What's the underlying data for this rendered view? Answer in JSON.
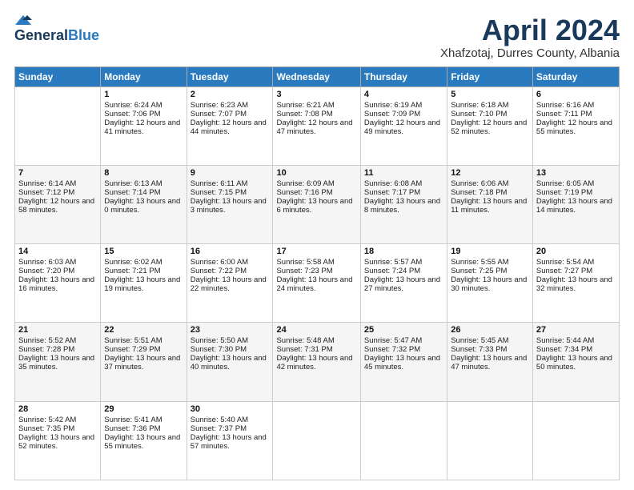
{
  "logo": {
    "line1": "General",
    "line2": "Blue"
  },
  "title": "April 2024",
  "location": "Xhafzotaj, Durres County, Albania",
  "weekdays": [
    "Sunday",
    "Monday",
    "Tuesday",
    "Wednesday",
    "Thursday",
    "Friday",
    "Saturday"
  ],
  "weeks": [
    [
      {
        "day": "",
        "sunrise": "",
        "sunset": "",
        "daylight": ""
      },
      {
        "day": "1",
        "sunrise": "Sunrise: 6:24 AM",
        "sunset": "Sunset: 7:06 PM",
        "daylight": "Daylight: 12 hours and 41 minutes."
      },
      {
        "day": "2",
        "sunrise": "Sunrise: 6:23 AM",
        "sunset": "Sunset: 7:07 PM",
        "daylight": "Daylight: 12 hours and 44 minutes."
      },
      {
        "day": "3",
        "sunrise": "Sunrise: 6:21 AM",
        "sunset": "Sunset: 7:08 PM",
        "daylight": "Daylight: 12 hours and 47 minutes."
      },
      {
        "day": "4",
        "sunrise": "Sunrise: 6:19 AM",
        "sunset": "Sunset: 7:09 PM",
        "daylight": "Daylight: 12 hours and 49 minutes."
      },
      {
        "day": "5",
        "sunrise": "Sunrise: 6:18 AM",
        "sunset": "Sunset: 7:10 PM",
        "daylight": "Daylight: 12 hours and 52 minutes."
      },
      {
        "day": "6",
        "sunrise": "Sunrise: 6:16 AM",
        "sunset": "Sunset: 7:11 PM",
        "daylight": "Daylight: 12 hours and 55 minutes."
      }
    ],
    [
      {
        "day": "7",
        "sunrise": "Sunrise: 6:14 AM",
        "sunset": "Sunset: 7:12 PM",
        "daylight": "Daylight: 12 hours and 58 minutes."
      },
      {
        "day": "8",
        "sunrise": "Sunrise: 6:13 AM",
        "sunset": "Sunset: 7:14 PM",
        "daylight": "Daylight: 13 hours and 0 minutes."
      },
      {
        "day": "9",
        "sunrise": "Sunrise: 6:11 AM",
        "sunset": "Sunset: 7:15 PM",
        "daylight": "Daylight: 13 hours and 3 minutes."
      },
      {
        "day": "10",
        "sunrise": "Sunrise: 6:09 AM",
        "sunset": "Sunset: 7:16 PM",
        "daylight": "Daylight: 13 hours and 6 minutes."
      },
      {
        "day": "11",
        "sunrise": "Sunrise: 6:08 AM",
        "sunset": "Sunset: 7:17 PM",
        "daylight": "Daylight: 13 hours and 8 minutes."
      },
      {
        "day": "12",
        "sunrise": "Sunrise: 6:06 AM",
        "sunset": "Sunset: 7:18 PM",
        "daylight": "Daylight: 13 hours and 11 minutes."
      },
      {
        "day": "13",
        "sunrise": "Sunrise: 6:05 AM",
        "sunset": "Sunset: 7:19 PM",
        "daylight": "Daylight: 13 hours and 14 minutes."
      }
    ],
    [
      {
        "day": "14",
        "sunrise": "Sunrise: 6:03 AM",
        "sunset": "Sunset: 7:20 PM",
        "daylight": "Daylight: 13 hours and 16 minutes."
      },
      {
        "day": "15",
        "sunrise": "Sunrise: 6:02 AM",
        "sunset": "Sunset: 7:21 PM",
        "daylight": "Daylight: 13 hours and 19 minutes."
      },
      {
        "day": "16",
        "sunrise": "Sunrise: 6:00 AM",
        "sunset": "Sunset: 7:22 PM",
        "daylight": "Daylight: 13 hours and 22 minutes."
      },
      {
        "day": "17",
        "sunrise": "Sunrise: 5:58 AM",
        "sunset": "Sunset: 7:23 PM",
        "daylight": "Daylight: 13 hours and 24 minutes."
      },
      {
        "day": "18",
        "sunrise": "Sunrise: 5:57 AM",
        "sunset": "Sunset: 7:24 PM",
        "daylight": "Daylight: 13 hours and 27 minutes."
      },
      {
        "day": "19",
        "sunrise": "Sunrise: 5:55 AM",
        "sunset": "Sunset: 7:25 PM",
        "daylight": "Daylight: 13 hours and 30 minutes."
      },
      {
        "day": "20",
        "sunrise": "Sunrise: 5:54 AM",
        "sunset": "Sunset: 7:27 PM",
        "daylight": "Daylight: 13 hours and 32 minutes."
      }
    ],
    [
      {
        "day": "21",
        "sunrise": "Sunrise: 5:52 AM",
        "sunset": "Sunset: 7:28 PM",
        "daylight": "Daylight: 13 hours and 35 minutes."
      },
      {
        "day": "22",
        "sunrise": "Sunrise: 5:51 AM",
        "sunset": "Sunset: 7:29 PM",
        "daylight": "Daylight: 13 hours and 37 minutes."
      },
      {
        "day": "23",
        "sunrise": "Sunrise: 5:50 AM",
        "sunset": "Sunset: 7:30 PM",
        "daylight": "Daylight: 13 hours and 40 minutes."
      },
      {
        "day": "24",
        "sunrise": "Sunrise: 5:48 AM",
        "sunset": "Sunset: 7:31 PM",
        "daylight": "Daylight: 13 hours and 42 minutes."
      },
      {
        "day": "25",
        "sunrise": "Sunrise: 5:47 AM",
        "sunset": "Sunset: 7:32 PM",
        "daylight": "Daylight: 13 hours and 45 minutes."
      },
      {
        "day": "26",
        "sunrise": "Sunrise: 5:45 AM",
        "sunset": "Sunset: 7:33 PM",
        "daylight": "Daylight: 13 hours and 47 minutes."
      },
      {
        "day": "27",
        "sunrise": "Sunrise: 5:44 AM",
        "sunset": "Sunset: 7:34 PM",
        "daylight": "Daylight: 13 hours and 50 minutes."
      }
    ],
    [
      {
        "day": "28",
        "sunrise": "Sunrise: 5:42 AM",
        "sunset": "Sunset: 7:35 PM",
        "daylight": "Daylight: 13 hours and 52 minutes."
      },
      {
        "day": "29",
        "sunrise": "Sunrise: 5:41 AM",
        "sunset": "Sunset: 7:36 PM",
        "daylight": "Daylight: 13 hours and 55 minutes."
      },
      {
        "day": "30",
        "sunrise": "Sunrise: 5:40 AM",
        "sunset": "Sunset: 7:37 PM",
        "daylight": "Daylight: 13 hours and 57 minutes."
      },
      {
        "day": "",
        "sunrise": "",
        "sunset": "",
        "daylight": ""
      },
      {
        "day": "",
        "sunrise": "",
        "sunset": "",
        "daylight": ""
      },
      {
        "day": "",
        "sunrise": "",
        "sunset": "",
        "daylight": ""
      },
      {
        "day": "",
        "sunrise": "",
        "sunset": "",
        "daylight": ""
      }
    ]
  ]
}
